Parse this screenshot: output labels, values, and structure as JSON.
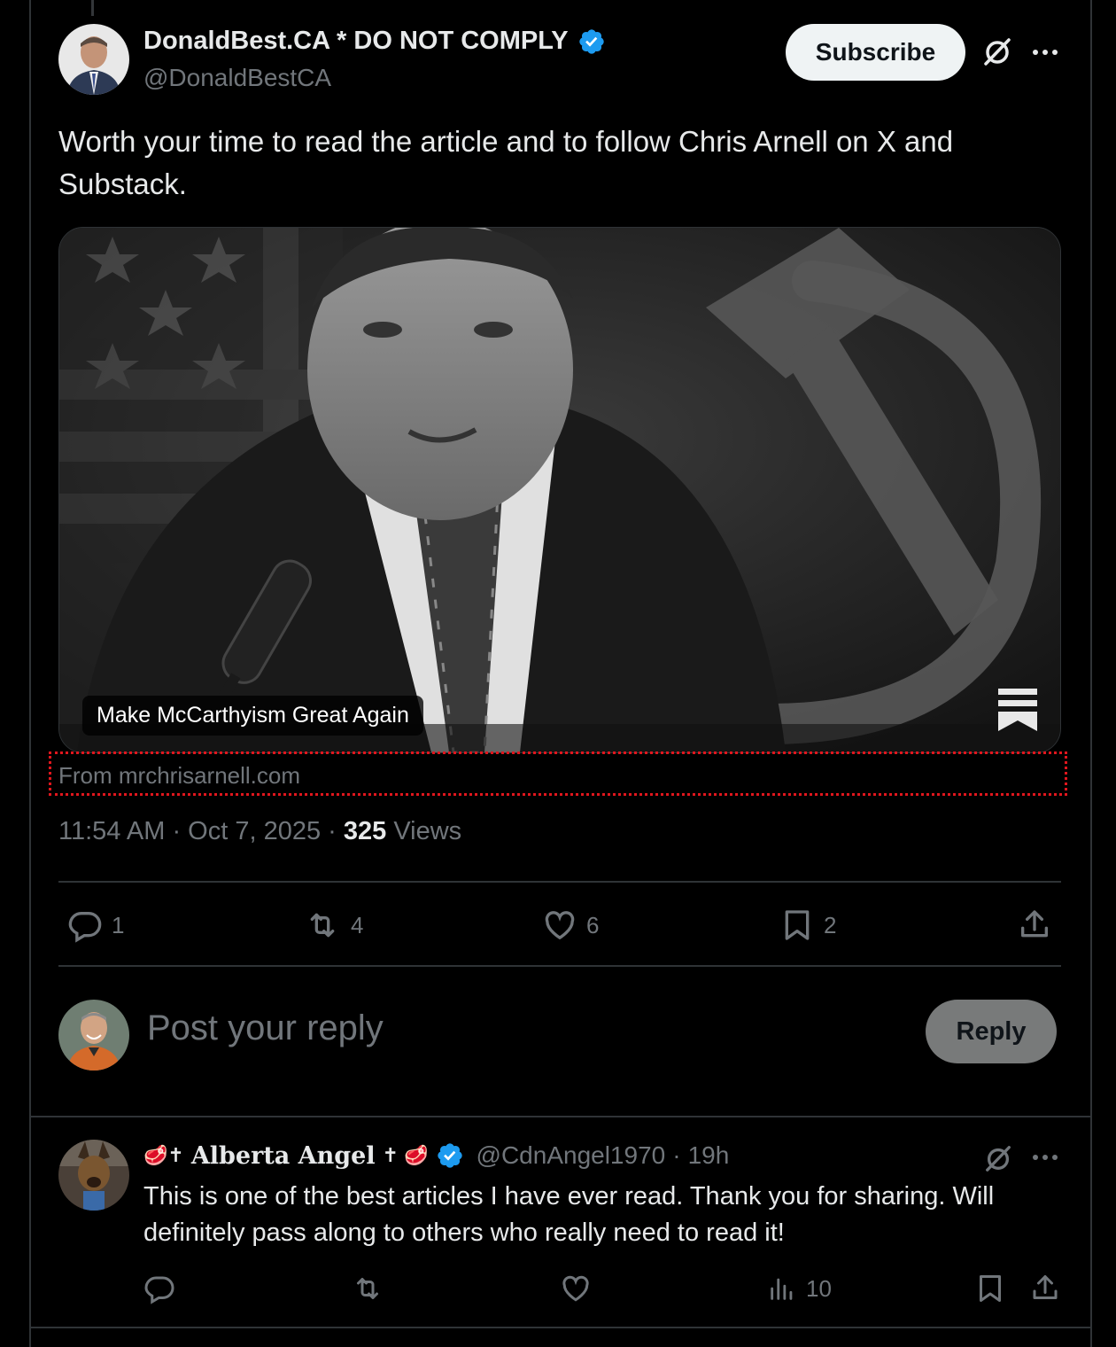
{
  "post": {
    "author_name": "DonaldBest.CA * DO NOT COMPLY",
    "author_handle": "@DonaldBestCA",
    "subscribe_label": "Subscribe",
    "text": "Worth your time to read the article and to follow Chris Arnell on X and Substack.",
    "card_title": "Make McCarthyism Great Again",
    "card_source": "From mrchrisarnell.com",
    "time": "11:54 AM",
    "date": "Oct 7, 2025",
    "views_count": "325",
    "views_label": "Views",
    "stats": {
      "replies": "1",
      "reposts": "4",
      "likes": "6",
      "bookmarks": "2"
    }
  },
  "composer": {
    "placeholder": "Post your reply",
    "reply_label": "Reply"
  },
  "reply": {
    "author_name_prefix": "🥩✝",
    "author_name": "Alberta Angel",
    "author_name_suffix": "✝ 🥩",
    "author_handle": "@CdnAngel1970",
    "time": "19h",
    "text": "This is one of the best articles I have ever read.  Thank you for sharing.  Will definitely pass along to others who really need to read it!",
    "views": "10"
  },
  "colors": {
    "background": "#000000",
    "text_primary": "#e7e9ea",
    "text_secondary": "#71767b",
    "verified": "#1d9bf0",
    "divider": "#2f3336",
    "highlight_box": "#e0161d"
  }
}
